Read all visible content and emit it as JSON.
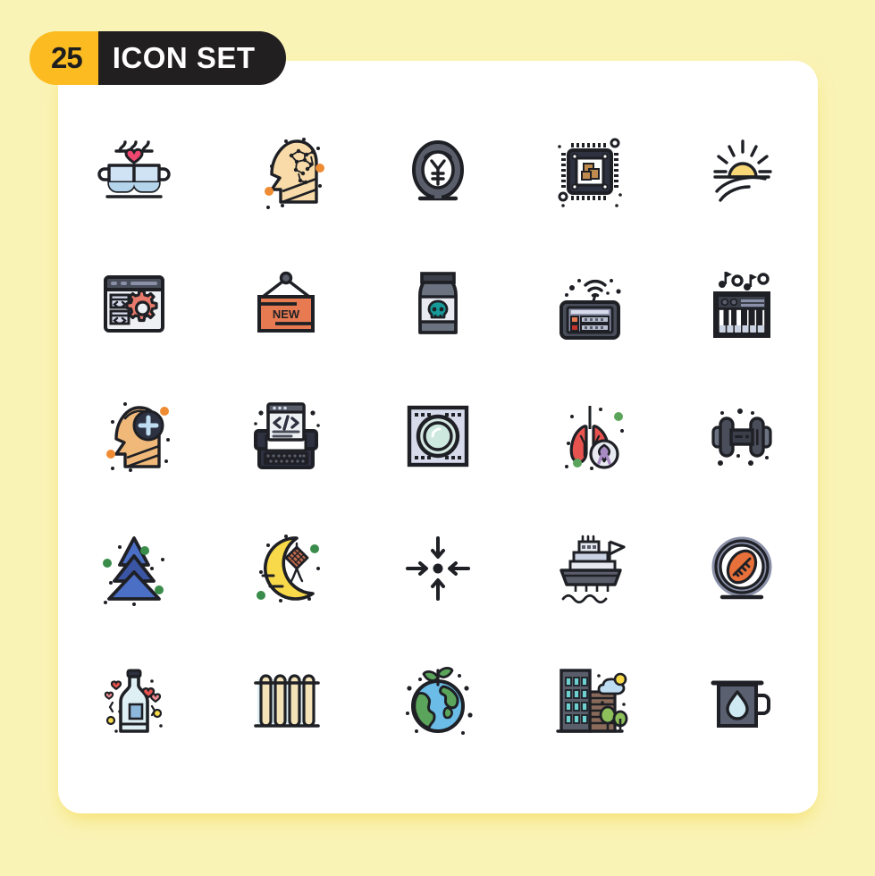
{
  "page": {
    "background_color": "#FAF3B6",
    "card_color": "#FFFFFF"
  },
  "badge": {
    "count": "25",
    "label": "ICON SET",
    "count_bg": "#FBBB21",
    "label_bg": "#221F20",
    "label_color": "#FFFFFF",
    "count_color": "#1E1E1E"
  },
  "icons": [
    {
      "name": "coffee-cups-love-icon",
      "label": "Coffee Cups Love",
      "row": 1,
      "col": 1,
      "colors": [
        "#BFDDF2",
        "#ED4C67",
        "#1E2025"
      ]
    },
    {
      "name": "head-brain-ai-icon",
      "label": "Head Brain AI",
      "row": 1,
      "col": 2,
      "colors": [
        "#F8DBA8",
        "#EF8B32",
        "#1E2025"
      ]
    },
    {
      "name": "yen-coin-icon",
      "label": "Yen Coin",
      "row": 1,
      "col": 3,
      "colors": [
        "#5A5E6B",
        "#FFFFFF",
        "#1E2025"
      ]
    },
    {
      "name": "cpu-processor-icon",
      "label": "CPU Processor",
      "row": 1,
      "col": 4,
      "colors": [
        "#2D3140",
        "#C08B4F",
        "#1E2025"
      ]
    },
    {
      "name": "sunrise-icon",
      "label": "Sunrise",
      "row": 1,
      "col": 5,
      "colors": [
        "#F8D777",
        "#1E2025"
      ]
    },
    {
      "name": "web-settings-icon",
      "label": "Web Development Settings",
      "row": 2,
      "col": 1,
      "colors": [
        "#EEF1F3",
        "#4A4E5A",
        "#E87A6B"
      ]
    },
    {
      "name": "new-sign-board-icon",
      "label": "New Sign Board",
      "row": 2,
      "col": 2,
      "colors": [
        "#E87A51",
        "#1E2025"
      ]
    },
    {
      "name": "poison-jar-icon",
      "label": "Poison Jar",
      "row": 2,
      "col": 3,
      "colors": [
        "#6B7280",
        "#E8EAF2",
        "#169A9A"
      ]
    },
    {
      "name": "wifi-router-icon",
      "label": "Wifi Router",
      "row": 2,
      "col": 4,
      "colors": [
        "#4A4E5A",
        "#E87A51",
        "#C4342F"
      ]
    },
    {
      "name": "piano-keyboard-icon",
      "label": "Piano Keyboard",
      "row": 2,
      "col": 5,
      "colors": [
        "#1E2025",
        "#D6DCE8",
        "#6B7280"
      ]
    },
    {
      "name": "head-add-icon",
      "label": "Add Person Mind",
      "row": 3,
      "col": 1,
      "colors": [
        "#F0B97A",
        "#2D3243",
        "#BFDDF2"
      ]
    },
    {
      "name": "typewriter-code-icon",
      "label": "Typewriter Code",
      "row": 3,
      "col": 2,
      "colors": [
        "#2D3140",
        "#E8EAF2",
        "#6B7280"
      ]
    },
    {
      "name": "washing-machine-icon",
      "label": "Washing Machine",
      "row": 3,
      "col": 3,
      "colors": [
        "#D6DAEA",
        "#CDE8DE",
        "#1E2025"
      ]
    },
    {
      "name": "lungs-ribbon-icon",
      "label": "Lungs Cancer Ribbon",
      "row": 3,
      "col": 4,
      "colors": [
        "#E8534F",
        "#A98BC4",
        "#5BA45B"
      ]
    },
    {
      "name": "dumbbell-icon",
      "label": "Dumbbell",
      "row": 3,
      "col": 5,
      "colors": [
        "#4A4E5A",
        "#6B7280",
        "#1E2025"
      ]
    },
    {
      "name": "pine-tree-icon",
      "label": "Pine Tree",
      "row": 4,
      "col": 1,
      "colors": [
        "#3B55A5",
        "#4A6FC4",
        "#4A9A5A"
      ]
    },
    {
      "name": "moon-ketupat-icon",
      "label": "Crescent Moon Ketupat",
      "row": 4,
      "col": 2,
      "colors": [
        "#F8D94A",
        "#C0694A",
        "#4A9A5A"
      ]
    },
    {
      "name": "collapse-arrows-icon",
      "label": "Collapse Arrows",
      "row": 4,
      "col": 3,
      "colors": [
        "#1E2025"
      ]
    },
    {
      "name": "cargo-ship-icon",
      "label": "Cargo Ship",
      "row": 4,
      "col": 4,
      "colors": [
        "#5A5E6B",
        "#D6DAEA",
        "#1E2025"
      ]
    },
    {
      "name": "football-ring-icon",
      "label": "Football Ring",
      "row": 4,
      "col": 5,
      "colors": [
        "#8A90A8",
        "#E8703A",
        "#1E2025"
      ]
    },
    {
      "name": "love-bottle-icon",
      "label": "Love Potion Bottle",
      "row": 5,
      "col": 1,
      "colors": [
        "#DFF0F5",
        "#E8534F",
        "#8DB8DC"
      ]
    },
    {
      "name": "radiator-icon",
      "label": "Radiator Heater",
      "row": 5,
      "col": 2,
      "colors": [
        "#F5E3B8",
        "#DFF0F5",
        "#1E2025"
      ]
    },
    {
      "name": "eco-earth-icon",
      "label": "Eco Earth Sprout",
      "row": 5,
      "col": 3,
      "colors": [
        "#5BA45B",
        "#6BBDE8",
        "#1E2025"
      ]
    },
    {
      "name": "city-building-icon",
      "label": "City Building",
      "row": 5,
      "col": 4,
      "colors": [
        "#5A5E6B",
        "#6ED0D0",
        "#8A6A5A"
      ]
    },
    {
      "name": "water-mug-icon",
      "label": "Water Mug",
      "row": 5,
      "col": 5,
      "colors": [
        "#5A6070",
        "#CFE9F2",
        "#1E2025"
      ]
    }
  ]
}
